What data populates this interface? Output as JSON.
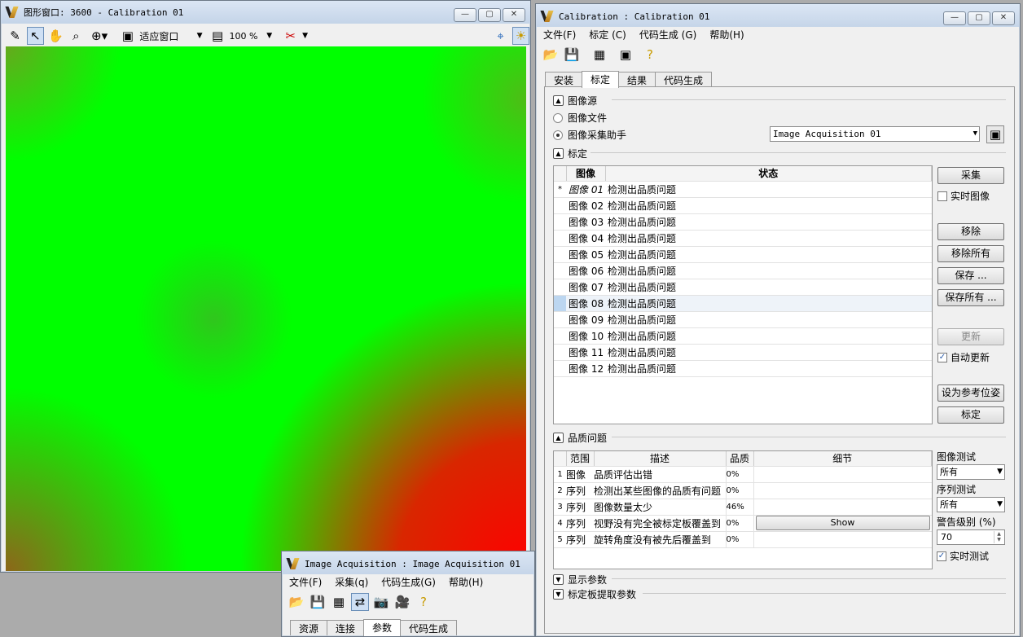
{
  "graphics_window": {
    "title": "图形窗口: 3600 - Calibration 01",
    "zoom_mode": "适应窗口",
    "zoom_percent": "100 %"
  },
  "calibration_window": {
    "title": "Calibration : Calibration 01",
    "menu": [
      "文件(F)",
      "标定 (C)",
      "代码生成 (G)",
      "帮助(H)"
    ],
    "tabs": [
      "安装",
      "标定",
      "结果",
      "代码生成"
    ],
    "image_source": {
      "section_label": "图像源",
      "options": [
        "图像文件",
        "图像采集助手"
      ],
      "selected_option": "图像采集助手",
      "acquisition_combo": "Image Acquisition 01"
    },
    "calib": {
      "section_label": "标定",
      "columns": [
        "图像",
        "状态"
      ],
      "rows": [
        {
          "marker": "*",
          "image": "图像 01",
          "status": "检测出品质问题"
        },
        {
          "marker": "",
          "image": "图像 02",
          "status": "检测出品质问题"
        },
        {
          "marker": "",
          "image": "图像 03",
          "status": "检测出品质问题"
        },
        {
          "marker": "",
          "image": "图像 04",
          "status": "检测出品质问题"
        },
        {
          "marker": "",
          "image": "图像 05",
          "status": "检测出品质问题"
        },
        {
          "marker": "",
          "image": "图像 06",
          "status": "检测出品质问题"
        },
        {
          "marker": "",
          "image": "图像 07",
          "status": "检测出品质问题"
        },
        {
          "marker": "",
          "image": "图像 08",
          "status": "检测出品质问题"
        },
        {
          "marker": "",
          "image": "图像 09",
          "status": "检测出品质问题"
        },
        {
          "marker": "",
          "image": "图像 10",
          "status": "检测出品质问题"
        },
        {
          "marker": "",
          "image": "图像 11",
          "status": "检测出品质问题"
        },
        {
          "marker": "",
          "image": "图像 12",
          "status": "检测出品质问题"
        }
      ],
      "buttons": {
        "acquire": "采集",
        "live_image": "实时图像",
        "remove": "移除",
        "remove_all": "移除所有",
        "save": "保存 ...",
        "save_all": "保存所有 ...",
        "update": "更新",
        "auto_update": "自动更新",
        "set_reference": "设为参考位姿",
        "calibrate": "标定"
      }
    },
    "quality": {
      "section_label": "品质问题",
      "columns": [
        "范围",
        "描述",
        "品质",
        "细节"
      ],
      "rows": [
        {
          "n": "1",
          "scope": "图像",
          "desc": "品质评估出错",
          "quality": "0%",
          "detail": ""
        },
        {
          "n": "2",
          "scope": "序列",
          "desc": "检测出某些图像的品质有问题",
          "quality": "0%",
          "detail": ""
        },
        {
          "n": "3",
          "scope": "序列",
          "desc": "图像数量太少",
          "quality": "46%",
          "detail": ""
        },
        {
          "n": "4",
          "scope": "序列",
          "desc": "视野没有完全被标定板覆盖到",
          "quality": "0%",
          "detail": "Show"
        },
        {
          "n": "5",
          "scope": "序列",
          "desc": "旋转角度没有被先后覆盖到",
          "quality": "0%",
          "detail": ""
        }
      ],
      "image_test_label": "图像测试",
      "image_test_value": "所有",
      "sequence_test_label": "序列测试",
      "sequence_test_value": "所有",
      "warning_level_label": "警告级别 (%)",
      "warning_level_value": "70",
      "live_test": "实时测试"
    },
    "display_params": "显示参数",
    "plate_extract_params": "标定板提取参数"
  },
  "acquisition_window": {
    "title": "Image Acquisition : Image Acquisition 01",
    "menu": [
      "文件(F)",
      "采集(q)",
      "代码生成(G)",
      "帮助(H)"
    ],
    "tabs": [
      "资源",
      "连接",
      "参数",
      "代码生成"
    ],
    "active_tab": "参数"
  },
  "colors": {
    "field_green": "#00ff00",
    "field_red": "#ff0000",
    "titlebar": "#c4d4e8"
  }
}
